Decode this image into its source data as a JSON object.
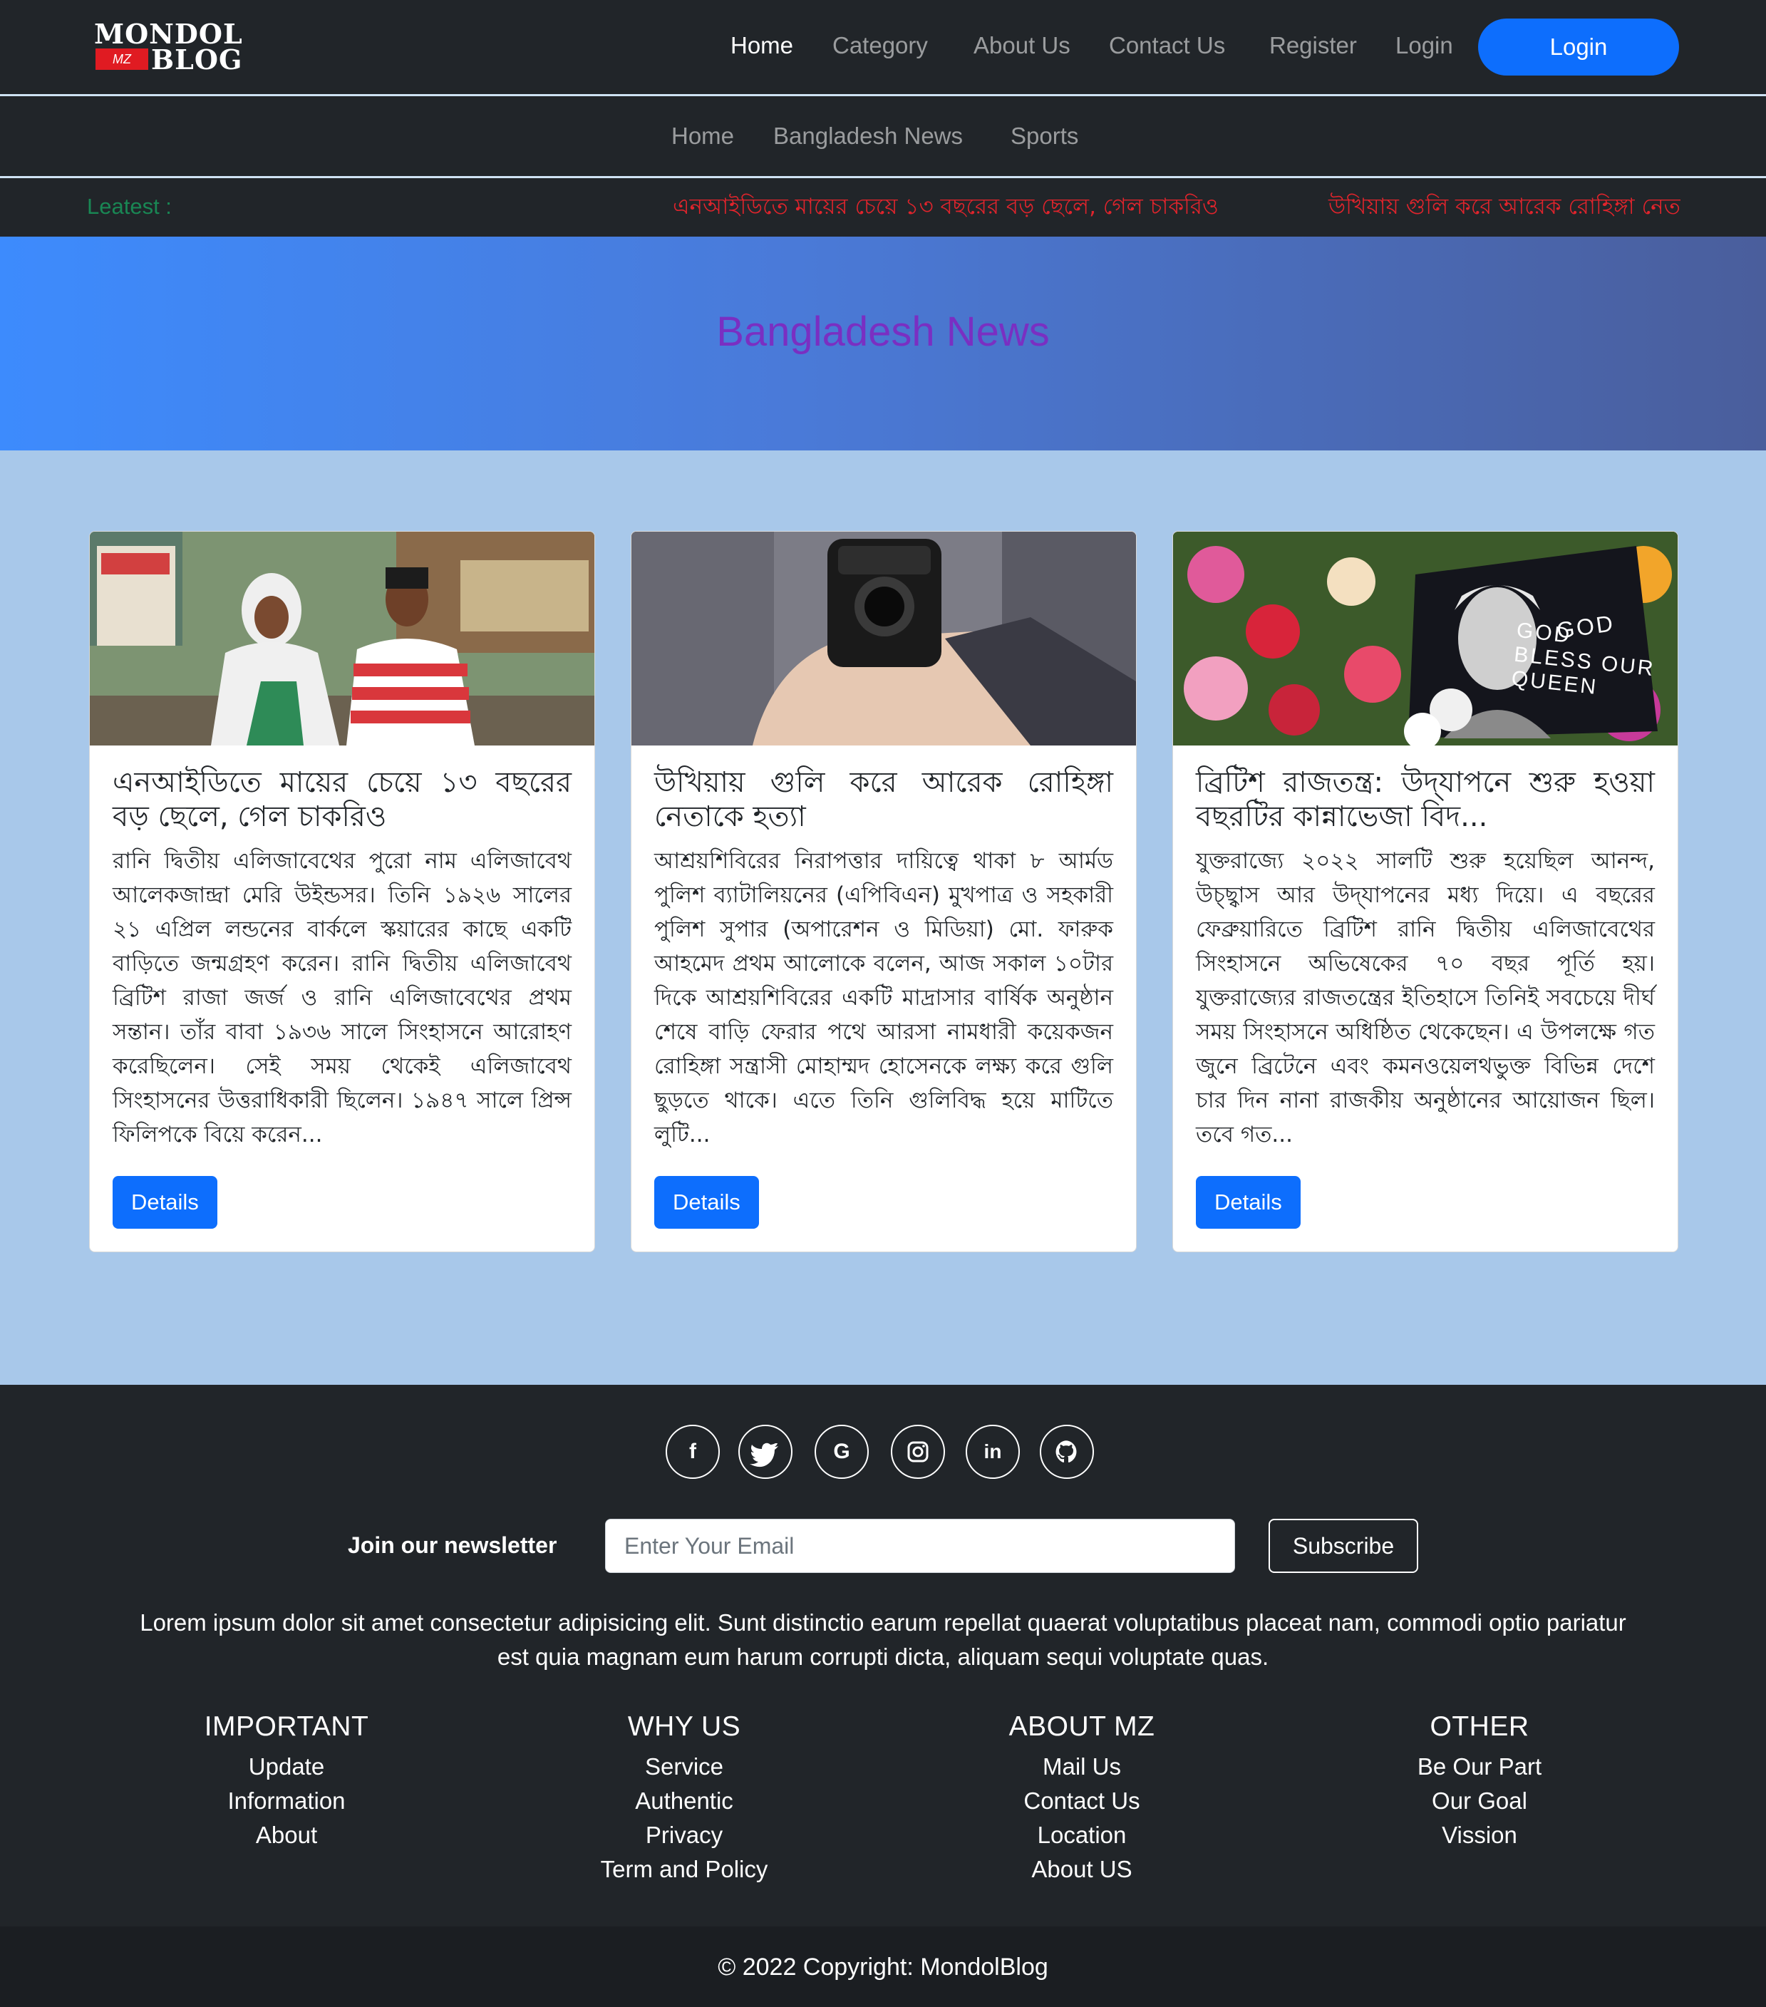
{
  "brand": {
    "line1": "MONDOL",
    "badge": "MZ",
    "line2": "BLOG"
  },
  "topnav": {
    "links": [
      "Home",
      "Category",
      "About Us",
      "Contact Us",
      "Register",
      "Login"
    ],
    "login_button": "Login"
  },
  "catnav": {
    "links": [
      "Home",
      "Bangladesh News",
      "Sports"
    ]
  },
  "ticker": {
    "label": "Leatest :",
    "items": [
      "এনআইডিতে মায়ের চেয়ে ১৩ বছরের বড় ছেলে, গেল চাকরিও",
      "উখিয়ায় গুলি করে আরেক রোহিঙ্গা নেতাকে হত্যা"
    ]
  },
  "hero": {
    "title": "Bangladesh News"
  },
  "cards": [
    {
      "title": "এনআইডিতে মায়ের চেয়ে ১৩ বছরের বড় ছেলে, গেল চাকরিও",
      "text": "রানি দ্বিতীয় এলিজাবেথের পুরো নাম এলিজাবেথ আলেকজান্দ্রা মেরি উইন্ডসর। তিনি ১৯২৬ সালের ২১ এপ্রিল লন্ডনের বার্কলে স্কয়ারের কাছে একটি বাড়িতে জন্মগ্রহণ করেন। রানি দ্বিতীয় এলিজাবেথ ব্রিটিশ রাজা জর্জ ও রানি এলিজাবেথের প্রথম সন্তান। তাঁর বাবা ১৯৩৬ সালে সিংহাসনে আরোহণ করেছিলেন। সেই সময় থেকেই এলিজাবেথ সিংহাসনের উত্তরাধিকারী ছিলেন। ১৯৪৭ সালে প্রিন্স ফিলিপকে বিয়ে করেন...",
      "button": "Details"
    },
    {
      "title": "উখিয়ায় গুলি করে আরেক রোহিঙ্গা নেতাকে হত্যা",
      "text": "আশ্রয়শিবিরের নিরাপত্তার দায়িত্বে থাকা ৮ আর্মড পুলিশ ব্যাটালিয়নের (এপিবিএন) মুখপাত্র ও সহকারী পুলিশ সুপার (অপারেশন ও মিডিয়া) মো. ফারুক আহমেদ প্রথম আলোকে বলেন, আজ সকাল ১০টার দিকে আশ্রয়শিবিরের একটি মাদ্রাসার বার্ষিক অনুষ্ঠান শেষে বাড়ি ফেরার পথে আরসা নামধারী কয়েকজন রোহিঙ্গা সন্ত্রাসী মোহাম্মদ হোসেনকে লক্ষ্য করে গুলি ছুড়তে থাকে। এতে তিনি গুলিবিদ্ধ হয়ে মাটিতে লুটি...",
      "button": "Details"
    },
    {
      "title": "ব্রিটিশ রাজতন্ত্র: উদ্‌যাপনে শুরু হওয়া বছরটির কান্নাভেজা বিদ...",
      "text": "যুক্তরাজ্যে ২০২২ সালটি শুরু হয়েছিল আনন্দ, উচ্ছ্বাস আর উদ্‌যাপনের মধ্য দিয়ে। এ বছরের ফেব্রুয়ারিতে ব্রিটিশ রানি দ্বিতীয় এলিজাবেথের সিংহাসনে অভিষেকের ৭০ বছর পূর্তি হয়। যুক্তরাজ্যের রাজতন্ত্রের ইতিহাসে তিনিই সবচেয়ে দীর্ঘ সময় সিংহাসনে অধিষ্ঠিত থেকেছেন। এ উপলক্ষে গত জুনে ব্রিটেনে এবং কমনওয়েলথভুক্ত বিভিন্ন দেশে চার দিন নানা রাজকীয় অনুষ্ঠানের আয়োজন ছিল। তবে গত...",
      "button": "Details",
      "image_text": "GOD BLESS OUR QUEEN"
    }
  ],
  "footer": {
    "social": [
      {
        "icon": "facebook-icon",
        "glyph": "f"
      },
      {
        "icon": "twitter-icon",
        "glyph": "🐦"
      },
      {
        "icon": "google-icon",
        "glyph": "G"
      },
      {
        "icon": "instagram-icon",
        "glyph": "◎"
      },
      {
        "icon": "linkedin-icon",
        "glyph": "in"
      },
      {
        "icon": "github-icon",
        "glyph": "⌾"
      }
    ],
    "newsletter_label": "Join our newsletter",
    "email_placeholder": "Enter Your Email",
    "subscribe_button": "Subscribe",
    "lorem": "Lorem ipsum dolor sit amet consectetur adipisicing elit. Sunt distinctio earum repellat quaerat voluptatibus placeat nam, commodi optio pariatur est quia magnam eum harum corrupti dicta, aliquam sequi voluptate quas.",
    "columns": [
      {
        "heading": "IMPORTANT",
        "links": [
          "Update",
          "Information",
          "About"
        ]
      },
      {
        "heading": "WHY US",
        "links": [
          "Service",
          "Authentic",
          "Privacy",
          "Term and Policy"
        ]
      },
      {
        "heading": "ABOUT MZ",
        "links": [
          "Mail Us",
          "Contact Us",
          "Location",
          "About US"
        ]
      },
      {
        "heading": "OTHER",
        "links": [
          "Be Our Part",
          "Our Goal",
          "Vission"
        ]
      }
    ],
    "copyright": "© 2022 Copyright: MondolBlog"
  }
}
